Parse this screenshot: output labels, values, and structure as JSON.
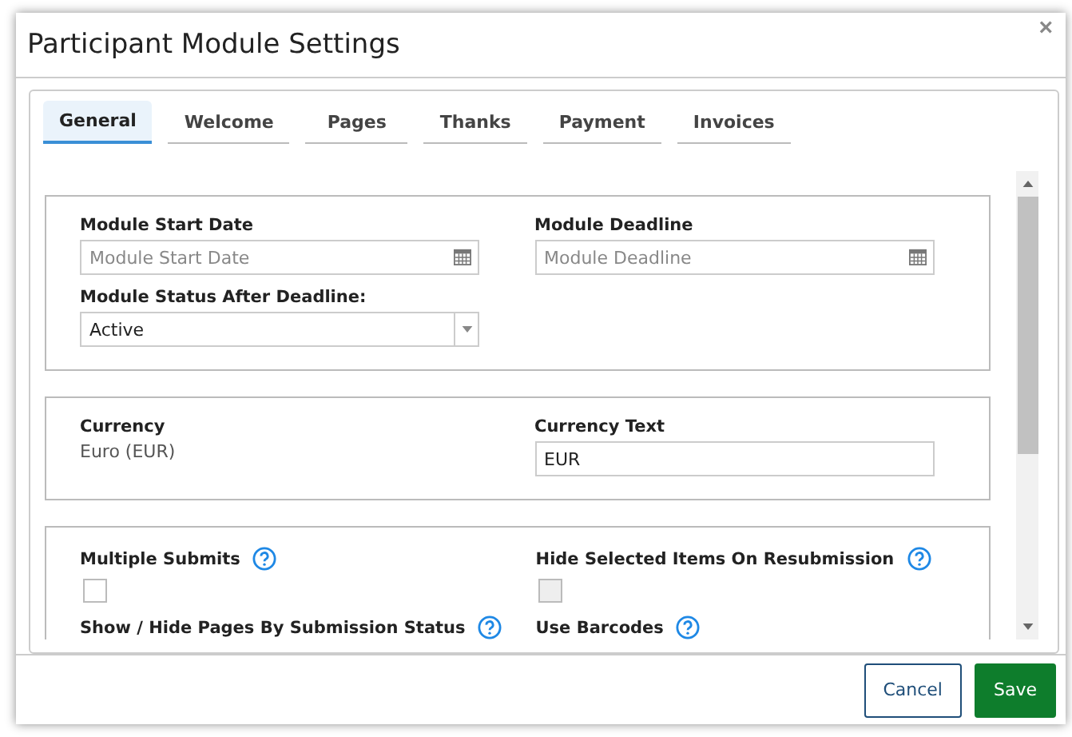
{
  "window": {
    "title": "Participant Module Settings",
    "close": "×"
  },
  "tabs": [
    {
      "label": "General",
      "selected": true
    },
    {
      "label": "Welcome",
      "selected": false
    },
    {
      "label": "Pages",
      "selected": false
    },
    {
      "label": "Thanks",
      "selected": false
    },
    {
      "label": "Payment",
      "selected": false
    },
    {
      "label": "Invoices",
      "selected": false
    }
  ],
  "sections": [
    {
      "fields": [
        {
          "kind": "date",
          "label": "Module Start Date",
          "placeholder": "Module Start Date"
        },
        {
          "kind": "date",
          "label": "Module Deadline",
          "placeholder": "Module Deadline"
        },
        {
          "kind": "select",
          "label": "Module Status After Deadline:",
          "value": "Active"
        }
      ]
    },
    {
      "fields": [
        {
          "kind": "static",
          "label": "Currency",
          "value": "Euro (EUR)"
        },
        {
          "kind": "text",
          "label": "Currency Text",
          "value": "EUR"
        }
      ]
    },
    {
      "fields": [
        {
          "kind": "checkbox",
          "label": "Multiple Submits",
          "help": true,
          "checked": false,
          "disabled": false
        },
        {
          "kind": "checkbox",
          "label": "Hide Selected Items On Resubmission",
          "help": true,
          "checked": false,
          "disabled": true
        },
        {
          "kind": "checkbox",
          "label": "Show / Hide Pages By Submission Status",
          "help": true
        },
        {
          "kind": "checkbox",
          "label": "Use Barcodes",
          "help": true
        }
      ]
    }
  ],
  "buttons": [
    {
      "label": "Cancel",
      "kind": "secondary"
    },
    {
      "label": "Save",
      "kind": "primary"
    }
  ]
}
